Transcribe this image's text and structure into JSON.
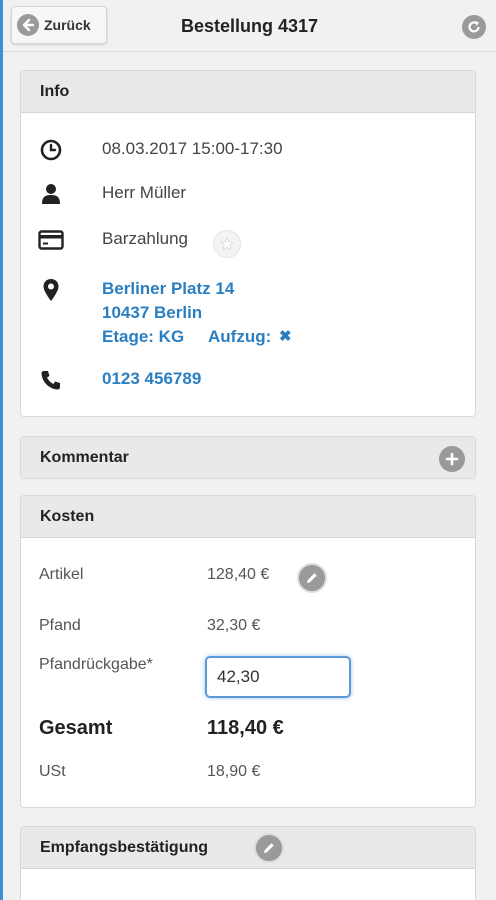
{
  "header": {
    "back_label": "Zurück",
    "title": "Bestellung 4317",
    "icons": {
      "back": "arrow-left-icon",
      "refresh": "refresh-icon"
    }
  },
  "info": {
    "title": "Info",
    "datetime": "08.03.2017 15:00-17:30",
    "customer": "Herr Müller",
    "payment": "Barzahlung",
    "address_street": "Berliner Platz 14",
    "address_city": "10437 Berlin",
    "floor": "Etage: KG",
    "elevator_label": "Aufzug:",
    "elevator_value": "✖",
    "phone": "0123 456789",
    "icons": {
      "datetime": "clock-icon",
      "customer": "user-icon",
      "payment": "credit-card-icon",
      "favorite": "star-icon",
      "address": "map-marker-icon",
      "phone": "phone-icon"
    }
  },
  "comment": {
    "title": "Kommentar",
    "add_icon": "plus-icon"
  },
  "costs": {
    "title": "Kosten",
    "items": [
      {
        "label": "Artikel",
        "value": "128,40 €"
      },
      {
        "label": "Pfand",
        "value": "32,30 €"
      }
    ],
    "deposit_return_label": "Pfandrückgabe*",
    "deposit_return_value": "42,30",
    "total_label": "Gesamt",
    "total_value": "118,40 €",
    "vat_label": "USt",
    "vat_value": "18,90 €",
    "edit_icon": "pencil-icon"
  },
  "receipt": {
    "title": "Empfangsbestätigung",
    "edit_icon": "pencil-icon"
  },
  "colors": {
    "link": "#2a7fc2",
    "accent": "#3d8fd6",
    "icon_gray": "#9a9a9a"
  }
}
